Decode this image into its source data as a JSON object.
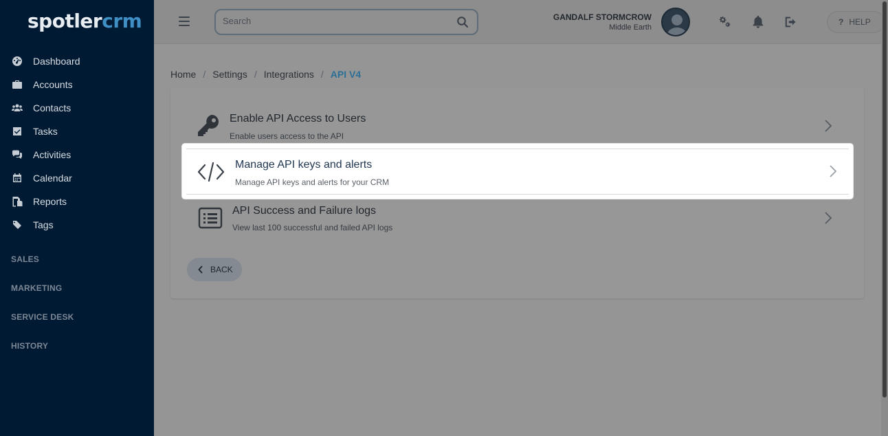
{
  "brand": {
    "part1": "spotler",
    "part2": "crm"
  },
  "sidebar": {
    "items": [
      {
        "label": "Dashboard",
        "icon": "dashboard-icon"
      },
      {
        "label": "Accounts",
        "icon": "briefcase-icon"
      },
      {
        "label": "Contacts",
        "icon": "users-icon"
      },
      {
        "label": "Tasks",
        "icon": "checkbox-icon"
      },
      {
        "label": "Activities",
        "icon": "comments-icon"
      },
      {
        "label": "Calendar",
        "icon": "calendar-icon"
      },
      {
        "label": "Reports",
        "icon": "copy-icon"
      },
      {
        "label": "Tags",
        "icon": "tags-icon"
      }
    ],
    "sections": [
      "SALES",
      "MARKETING",
      "SERVICE DESK",
      "HISTORY"
    ]
  },
  "topbar": {
    "search_placeholder": "Search",
    "user_name": "GANDALF STORMCROW",
    "user_location": "Middle Earth",
    "help_label": "HELP",
    "help_glyph": "?"
  },
  "breadcrumb": [
    "Home",
    "Settings",
    "Integrations",
    "API V4"
  ],
  "options": [
    {
      "title": "Enable API Access to Users",
      "subtitle": "Enable users access to the API",
      "icon": "key-icon"
    },
    {
      "title": "Manage API keys and alerts",
      "subtitle": "Manage API keys and alerts for your CRM",
      "icon": "code-icon"
    },
    {
      "title": "API Success and Failure logs",
      "subtitle": "View last 100 successful and failed API logs",
      "icon": "list-icon"
    }
  ],
  "back_label": "BACK",
  "colors": {
    "sidebar_bg": "#001a33",
    "accent": "#2b6f98",
    "brand_crm": "#3f8fc4",
    "overlay_bg": "#959595"
  }
}
